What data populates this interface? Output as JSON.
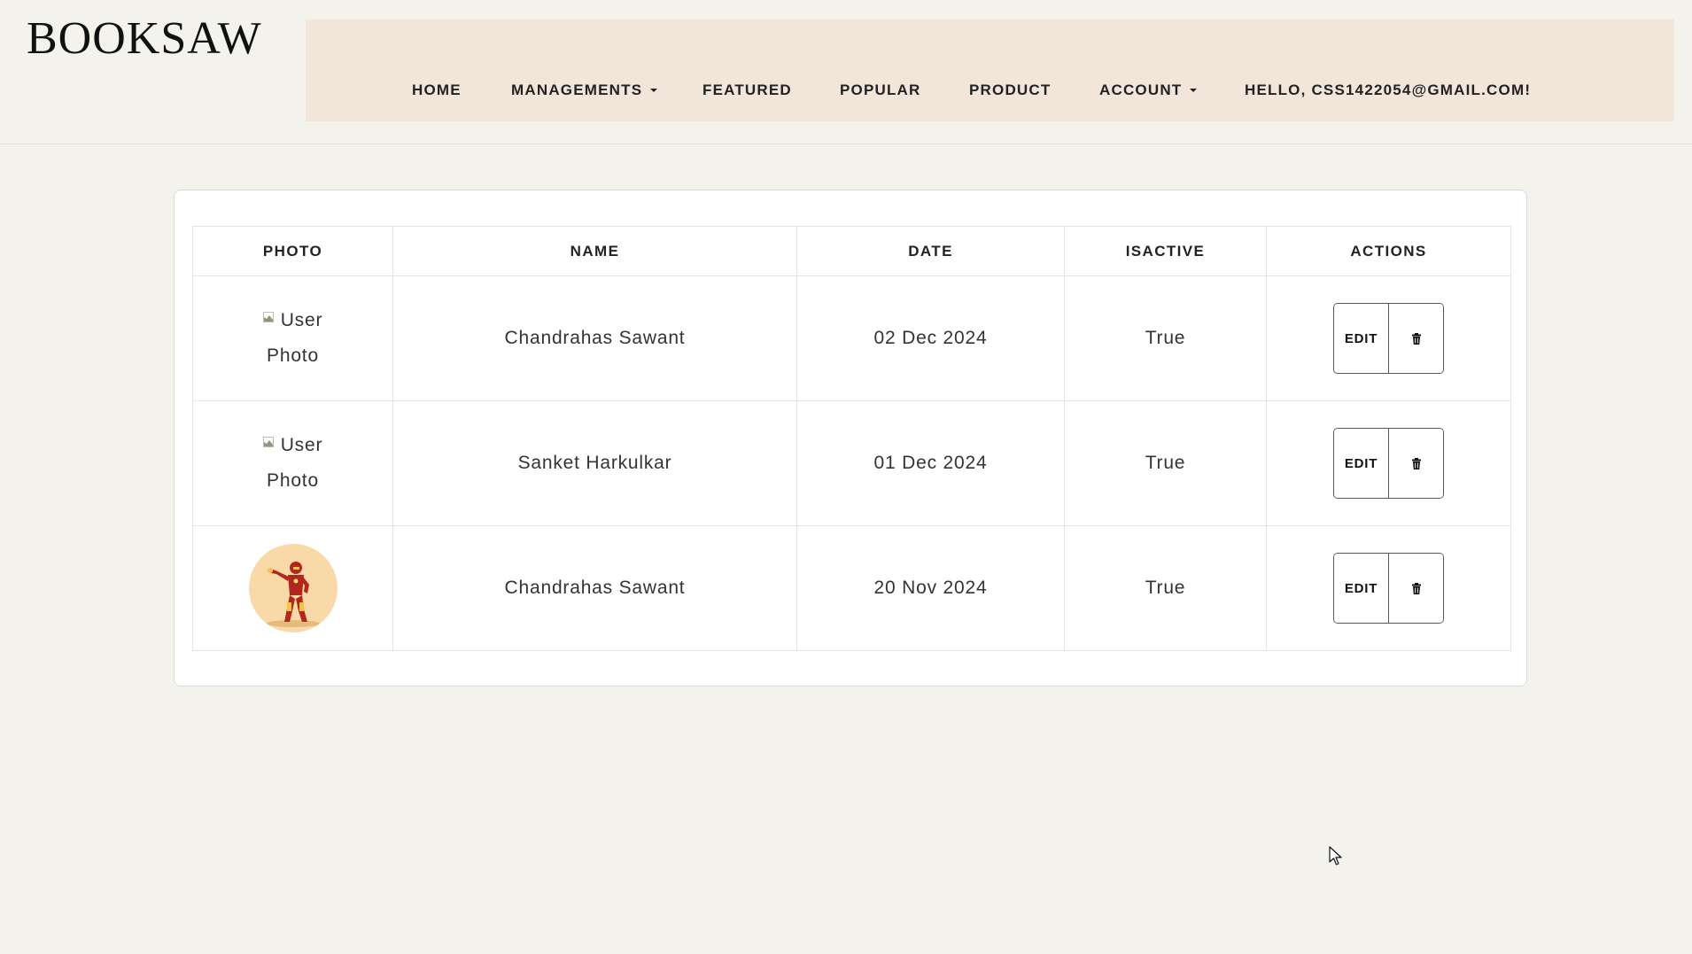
{
  "brand": {
    "logo_bold": "BOOK",
    "logo_light": "SAW"
  },
  "nav": {
    "items": [
      {
        "label": "HOME",
        "dropdown": false
      },
      {
        "label": "MANAGEMENTS",
        "dropdown": true
      },
      {
        "label": "FEATURED",
        "dropdown": false
      },
      {
        "label": "POPULAR",
        "dropdown": false
      },
      {
        "label": "PRODUCT",
        "dropdown": false
      },
      {
        "label": "ACCOUNT",
        "dropdown": true
      },
      {
        "label": "HELLO, CSS1422054@GMAIL.COM!",
        "dropdown": false
      }
    ]
  },
  "table": {
    "headers": [
      "PHOTO",
      "NAME",
      "DATE",
      "ISACTIVE",
      "ACTIONS"
    ],
    "rows": [
      {
        "photo": "broken",
        "photo_alt_1": "User",
        "photo_alt_2": "Photo",
        "name": "Chandrahas Sawant",
        "date": "02 Dec 2024",
        "isactive": "True",
        "edit_label": "EDIT"
      },
      {
        "photo": "broken",
        "photo_alt_1": "User",
        "photo_alt_2": "Photo",
        "name": "Sanket Harkulkar",
        "date": "01 Dec 2024",
        "isactive": "True",
        "edit_label": "EDIT"
      },
      {
        "photo": "avatar",
        "name": "Chandrahas Sawant",
        "date": "20 Nov 2024",
        "isactive": "True",
        "edit_label": "EDIT"
      }
    ]
  },
  "colors": {
    "page_bg": "#f3f2ec",
    "nav_bg": "#f2e6da",
    "avatar_bg": "#f9d9a8",
    "text": "#333333"
  }
}
